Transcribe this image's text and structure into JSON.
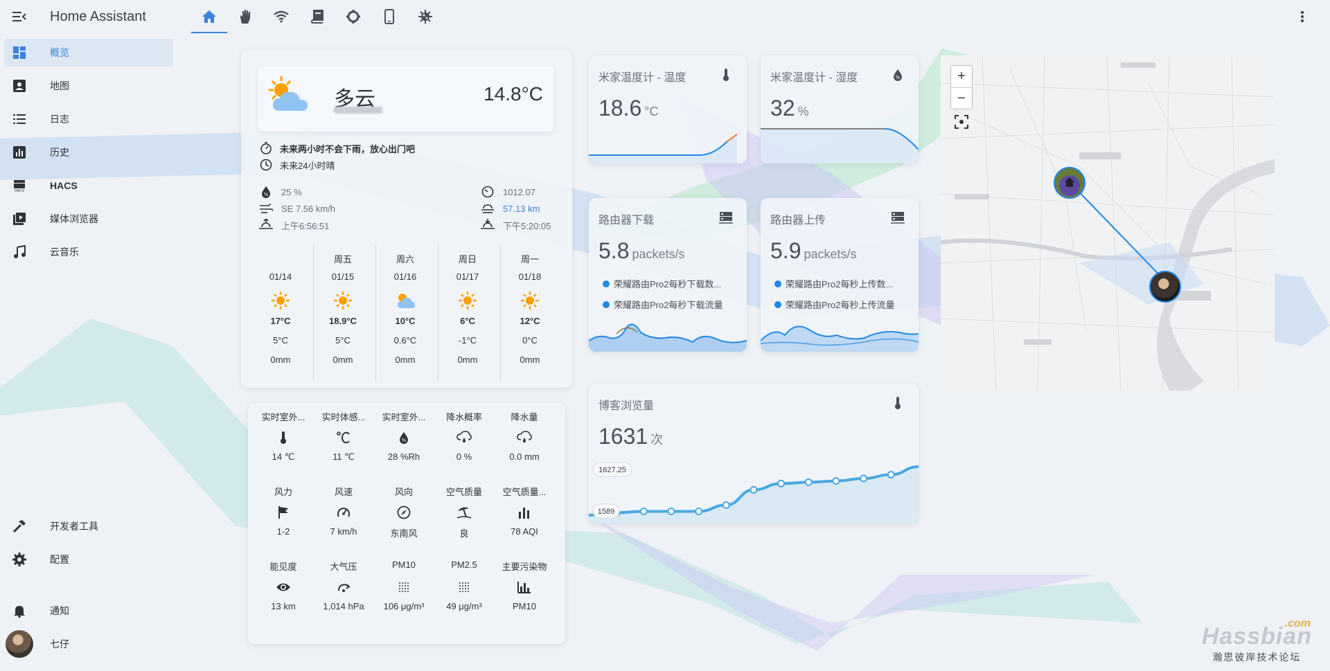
{
  "app": {
    "title": "Home Assistant"
  },
  "sidebar": {
    "items": [
      {
        "label": "概览",
        "icon": "dashboard-icon",
        "active": true
      },
      {
        "label": "地图",
        "icon": "map-account-icon"
      },
      {
        "label": "日志",
        "icon": "logbook-list-icon"
      },
      {
        "label": "历史",
        "icon": "history-chart-icon"
      },
      {
        "label": "HACS",
        "icon": "hacs-icon"
      },
      {
        "label": "媒体浏览器",
        "icon": "media-browser-icon"
      },
      {
        "label": "云音乐",
        "icon": "music-note-icon"
      }
    ],
    "bottom": [
      {
        "label": "开发者工具",
        "icon": "hammer-icon"
      },
      {
        "label": "配置",
        "icon": "gear-icon"
      },
      {
        "label": "通知",
        "icon": "bell-icon"
      },
      {
        "label": "七仔",
        "icon": "user-avatar"
      }
    ]
  },
  "tabs": [
    {
      "icon": "home-icon",
      "active": true
    },
    {
      "icon": "hand-icon"
    },
    {
      "icon": "wifi-icon"
    },
    {
      "icon": "book-icon"
    },
    {
      "icon": "settings-icon"
    },
    {
      "icon": "phone-icon"
    },
    {
      "icon": "virus-icon"
    }
  ],
  "weather": {
    "condition": "多云",
    "temperature": "14.8°C",
    "rain_forecast": "未来两小时不会下雨，放心出门吧",
    "forecast_24h": "未来24小时晴",
    "humidity": "25 %",
    "wind": "SE 7.56 km/h",
    "sunrise": "上午6:56:51",
    "pressure": "1012.07",
    "visibility": "57.13 km",
    "sunset": "下午5:20:05",
    "forecast": [
      {
        "day": "",
        "date": "01/14",
        "icon": "sunny",
        "high": "17°C",
        "low": "5°C",
        "precip": "0mm"
      },
      {
        "day": "周五",
        "date": "01/15",
        "icon": "sunny",
        "high": "18.9°C",
        "low": "5°C",
        "precip": "0mm"
      },
      {
        "day": "周六",
        "date": "01/16",
        "icon": "partly-cloudy",
        "high": "10°C",
        "low": "0.6°C",
        "precip": "0mm"
      },
      {
        "day": "周日",
        "date": "01/17",
        "icon": "sunny",
        "high": "6°C",
        "low": "-1°C",
        "precip": "0mm"
      },
      {
        "day": "周一",
        "date": "01/18",
        "icon": "sunny",
        "high": "12°C",
        "low": "0°C",
        "precip": "0mm"
      }
    ]
  },
  "attributes": [
    {
      "label": "实时室外...",
      "icon": "thermometer-icon",
      "value": "14 ℃"
    },
    {
      "label": "实时体感...",
      "icon": "celsius-icon",
      "value": "11 ℃"
    },
    {
      "label": "实时室外...",
      "icon": "water-percent-icon",
      "value": "28 %Rh"
    },
    {
      "label": "降水概率",
      "icon": "cloud-rain-icon",
      "value": "0 %"
    },
    {
      "label": "降水量",
      "icon": "cloud-rain-icon",
      "value": "0.0 mm"
    },
    {
      "label": "风力",
      "icon": "flag-icon",
      "value": "1-2"
    },
    {
      "label": "风速",
      "icon": "speedometer-icon",
      "value": "7 km/h"
    },
    {
      "label": "风向",
      "icon": "compass-icon",
      "value": "东南风"
    },
    {
      "label": "空气质量",
      "icon": "beach-umbrella-icon",
      "value": "良"
    },
    {
      "label": "空气质量...",
      "icon": "bar-chart-icon",
      "value": "78 AQI"
    },
    {
      "label": "能见度",
      "icon": "eye-icon",
      "value": "13 km"
    },
    {
      "label": "大气压",
      "icon": "gauge-arrow-icon",
      "value": "1,014 hPa"
    },
    {
      "label": "PM10",
      "icon": "dots-grid-icon",
      "value": "106 μg/m³"
    },
    {
      "label": "PM2.5",
      "icon": "dots-grid-icon",
      "value": "49 μg/m³"
    },
    {
      "label": "主要污染物",
      "icon": "chart-bar-stacked-icon",
      "value": "PM10"
    }
  ],
  "sensors": {
    "temp": {
      "name": "米家温度计 - 温度",
      "value": "18.6",
      "unit": "°C"
    },
    "humidity": {
      "name": "米家温度计 - 湿度",
      "value": "32",
      "unit": "%"
    },
    "router_down": {
      "name": "路由器下载",
      "value": "5.8",
      "unit": "packets/s",
      "legend": [
        "荣耀路由Pro2每秒下载数...",
        "荣耀路由Pro2每秒下载流量"
      ]
    },
    "router_up": {
      "name": "路由器上传",
      "value": "5.9",
      "unit": "packets/s",
      "legend": [
        "荣耀路由Pro2每秒上传数...",
        "荣耀路由Pro2每秒上传流量"
      ]
    },
    "blog": {
      "name": "博客浏览量",
      "value": "1631",
      "unit": "次",
      "max_label": "1627.25",
      "min_label": "1589"
    }
  },
  "chart_data": {
    "type": "line",
    "title": "博客浏览量",
    "values": [
      1589,
      1591,
      1592,
      1592,
      1592,
      1597,
      1609,
      1614,
      1615,
      1616,
      1618,
      1621,
      1627.25
    ]
  },
  "map": {
    "zoom_in": "+",
    "zoom_out": "−"
  },
  "watermark": {
    "main": "Hassbian",
    "com": ".com",
    "sub": "瀚思彼岸技术论坛"
  },
  "colors": {
    "accent": "#3f82d9",
    "line_blue": "#1e88e5",
    "sun": "#ffa000"
  }
}
